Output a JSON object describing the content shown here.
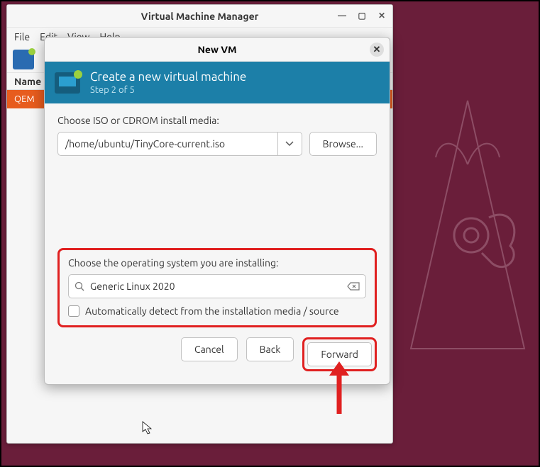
{
  "window": {
    "title": "Virtual Machine Manager",
    "menu": {
      "file": "File",
      "edit": "Edit",
      "view": "View",
      "help": "Help"
    },
    "column_header": "Name",
    "host_row": "QEM"
  },
  "dialog": {
    "title": "New VM",
    "banner_title": "Create a new virtual machine",
    "banner_step": "Step 2 of 5",
    "iso_label": "Choose ISO or CDROM install media:",
    "iso_path": "/home/ubuntu/TinyCore-current.iso",
    "browse": "Browse...",
    "os_label": "Choose the operating system you are installing:",
    "os_value": "Generic Linux 2020",
    "autodetect": "Automatically detect from the installation media / source",
    "cancel": "Cancel",
    "back": "Back",
    "forward": "Forward"
  }
}
